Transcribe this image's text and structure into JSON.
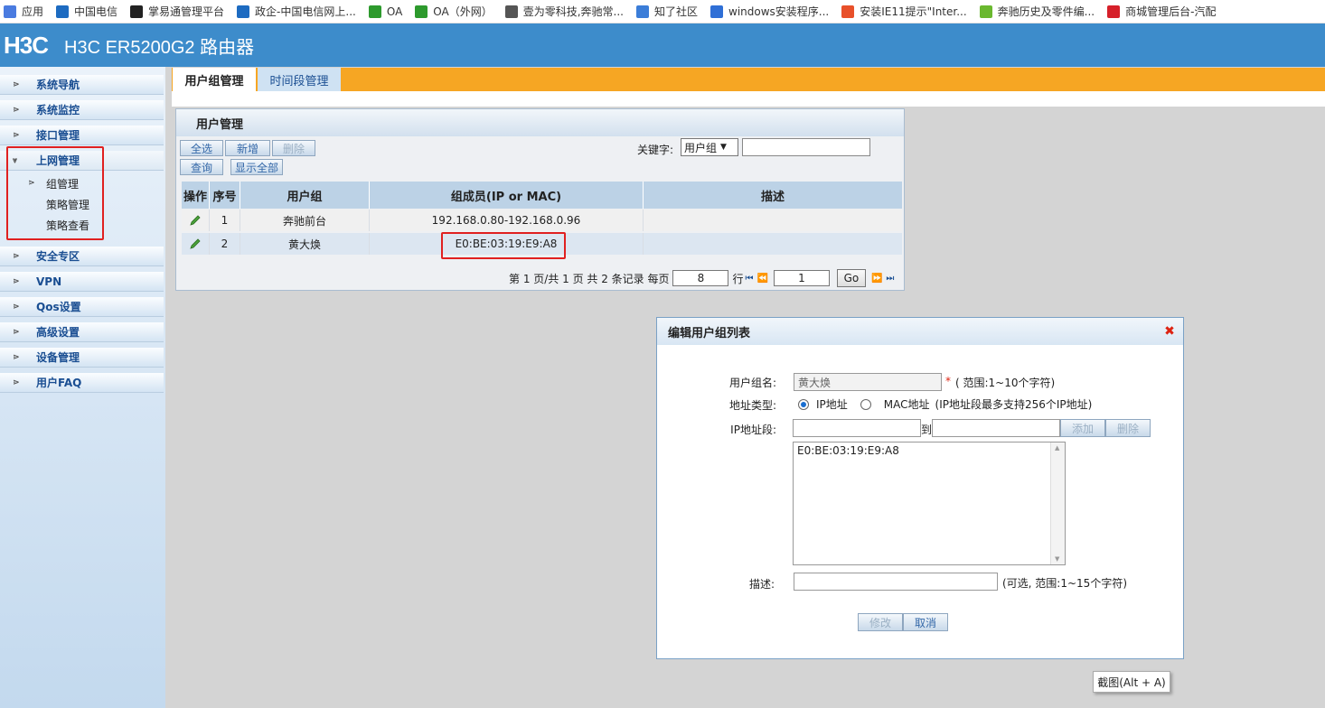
{
  "bookmarks": [
    {
      "label": "应用",
      "color": "#4a7be0"
    },
    {
      "label": "中国电信",
      "color": "#1d6bc1"
    },
    {
      "label": "掌易通管理平台",
      "color": "#222222"
    },
    {
      "label": "政企-中国电信网上...",
      "color": "#1d6bc1"
    },
    {
      "label": "OA",
      "color": "#2d9a2d"
    },
    {
      "label": "OA（外网）",
      "color": "#2d9a2d"
    },
    {
      "label": "壹为零科技,奔驰常...",
      "color": "#555555"
    },
    {
      "label": "知了社区",
      "color": "#3b7dd8"
    },
    {
      "label": "windows安装程序...",
      "color": "#2f6fd6"
    },
    {
      "label": "安装IE11提示\"Inter...",
      "color": "#e8502a"
    },
    {
      "label": "奔驰历史及零件编...",
      "color": "#6ab82f"
    },
    {
      "label": "商城管理后台-汽配",
      "color": "#d6202a"
    }
  ],
  "header": {
    "logo": "H3C",
    "model": "H3C ER5200G2 路由器"
  },
  "nav": {
    "items": [
      "系统导航",
      "系统监控",
      "接口管理",
      "上网管理"
    ],
    "sub": [
      "组管理",
      "策略管理",
      "策略查看"
    ],
    "items2": [
      "安全专区",
      "VPN",
      "Qos设置",
      "高级设置",
      "设备管理",
      "用户FAQ"
    ]
  },
  "tabs": [
    "用户组管理",
    "时间段管理"
  ],
  "panel": {
    "title": "用户管理",
    "buttons": {
      "select_all": "全选",
      "add": "新增",
      "delete": "删除",
      "query": "查询",
      "show_all": "显示全部"
    },
    "keyword_label": "关键字:",
    "keyword_select": "用户组",
    "columns": [
      "操作",
      "序号",
      "用户组",
      "组成员(IP or MAC)",
      "描述"
    ],
    "rows": [
      {
        "no": "1",
        "group": "奔驰前台",
        "member": "192.168.0.80-192.168.0.96",
        "desc": ""
      },
      {
        "no": "2",
        "group": "黄大焕",
        "member": "E0:BE:03:19:E9:A8",
        "desc": ""
      }
    ],
    "pager": {
      "text": "第 1 页/共 1 页 共 2 条记录 每页",
      "per_page": "8",
      "row_unit": "行",
      "page": "1",
      "go": "Go"
    }
  },
  "modal": {
    "title": "编辑用户组列表",
    "name_label": "用户组名:",
    "name_value": "黄大焕",
    "name_hint": "( 范围:1~10个字符)",
    "required_mark": "*",
    "type_label": "地址类型:",
    "type_ip": "IP地址",
    "type_mac": "MAC地址",
    "type_hint": "(IP地址段最多支持256个IP地址)",
    "range_label": "IP地址段:",
    "to_label": "到",
    "add_btn": "添加",
    "del_btn": "删除",
    "list_entry": "E0:BE:03:19:E9:A8",
    "desc_label": "描述:",
    "desc_hint": "(可选, 范围:1~15个字符)",
    "modify_btn": "修改",
    "cancel_btn": "取消"
  },
  "tooltip": "截图(Alt + A)"
}
